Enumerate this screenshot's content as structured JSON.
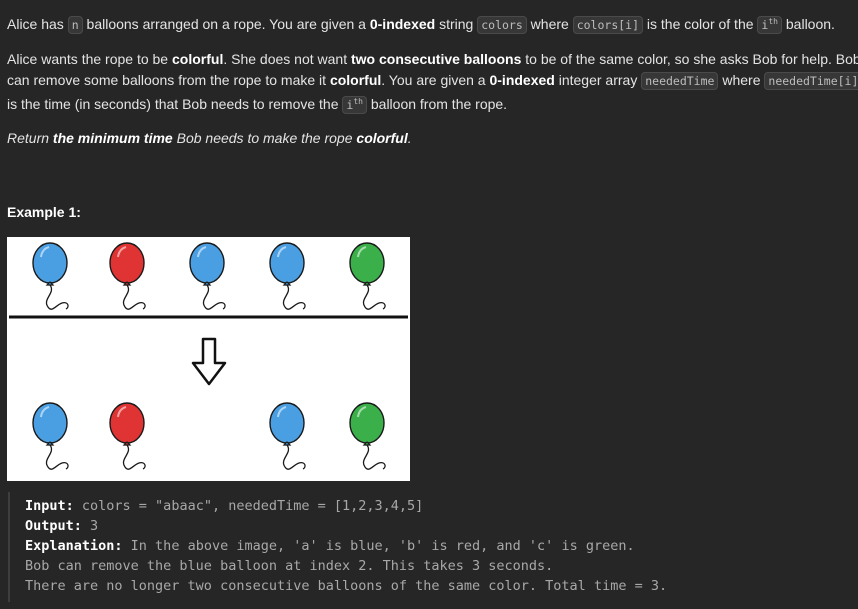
{
  "paragraph1": {
    "t1": "Alice has ",
    "c1": "n",
    "t2": " balloons arranged on a rope. You are given a ",
    "b1": "0-indexed",
    "t3": " string ",
    "c2": "colors",
    "t4": " where ",
    "c3": "colors[i]",
    "t5": " is the color of the ",
    "c4_base": "i",
    "c4_sup": "th",
    "t6": " balloon."
  },
  "paragraph2": {
    "l1_t1": "Alice wants the rope to be ",
    "l1_b1": "colorful",
    "l1_t2": ". She does not want ",
    "l1_b2": "two consecutive balloons",
    "l1_t3": " to be of the same color, so she asks Bob for help. Bob",
    "l2_t1": "can remove some balloons from the rope to make it ",
    "l2_b1": "colorful",
    "l2_t2": ". You are given a ",
    "l2_b2": "0-indexed",
    "l2_t3": " integer array ",
    "l2_c1": "neededTime",
    "l2_t4": " where ",
    "l2_c2": "neededTime[i]",
    "l3_t1": "is the time (in seconds) that Bob needs to remove the ",
    "l3_c1_base": "i",
    "l3_c1_sup": "th",
    "l3_t2": " balloon from the rope."
  },
  "paragraph3": {
    "i1": "Return ",
    "bi1": "the minimum time",
    "i2": " Bob needs to make the rope ",
    "bi2": "colorful",
    "i3": "."
  },
  "example_heading": "Example 1:",
  "figure": {
    "top_row": [
      "blue",
      "red",
      "blue",
      "blue",
      "green"
    ],
    "bottom_row": [
      "blue",
      "red",
      "",
      "blue",
      "green"
    ],
    "colors": {
      "blue": "#4a9fe3",
      "red": "#e03434",
      "green": "#3bb04a"
    }
  },
  "example": {
    "input_label": "Input:",
    "input_value": " colors = \"abaac\", neededTime = [1,2,3,4,5]",
    "output_label": "Output:",
    "output_value": " 3",
    "explanation_label": "Explanation:",
    "explanation_line1": " In the above image, 'a' is blue, 'b' is red, and 'c' is green.",
    "explanation_line2": "Bob can remove the blue balloon at index 2. This takes 3 seconds.",
    "explanation_line3": "There are no longer two consecutive balloons of the same color. Total time = 3."
  }
}
